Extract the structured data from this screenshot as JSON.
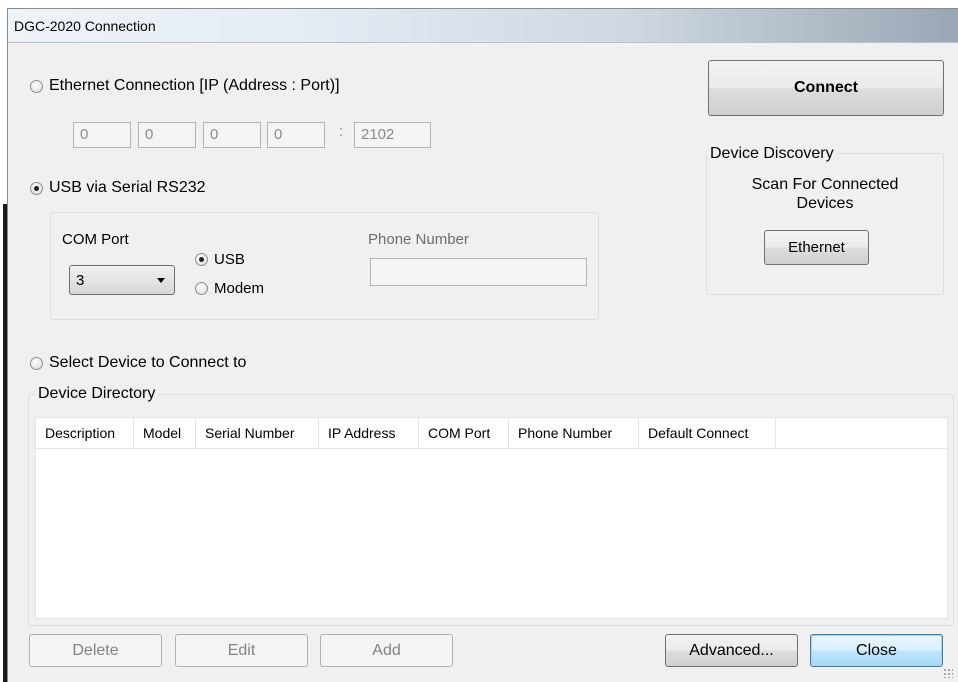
{
  "window": {
    "title": "DGC-2020 Connection"
  },
  "ethernet": {
    "radio_label": "Ethernet Connection [IP (Address : Port)]",
    "ip": [
      "0",
      "0",
      "0",
      "0"
    ],
    "separator": ":",
    "port": "2102"
  },
  "usb": {
    "radio_label": "USB via Serial RS232",
    "com_port_label": "COM Port",
    "com_port_value": "3",
    "usb_label": "USB",
    "modem_label": "Modem",
    "phone_label": "Phone Number",
    "phone_value": ""
  },
  "select_device": {
    "radio_label": "Select Device to Connect to"
  },
  "directory": {
    "legend": "Device Directory",
    "columns": [
      "Description",
      "Model",
      "Serial Number",
      "IP Address",
      "COM Port",
      "Phone Number",
      "Default Connect"
    ]
  },
  "discovery": {
    "legend": "Device Discovery",
    "scan_line1": "Scan For Connected",
    "scan_line2": "Devices",
    "ethernet_button": "Ethernet"
  },
  "buttons": {
    "connect": "Connect",
    "delete": "Delete",
    "edit": "Edit",
    "add": "Add",
    "advanced": "Advanced...",
    "close": "Close"
  }
}
